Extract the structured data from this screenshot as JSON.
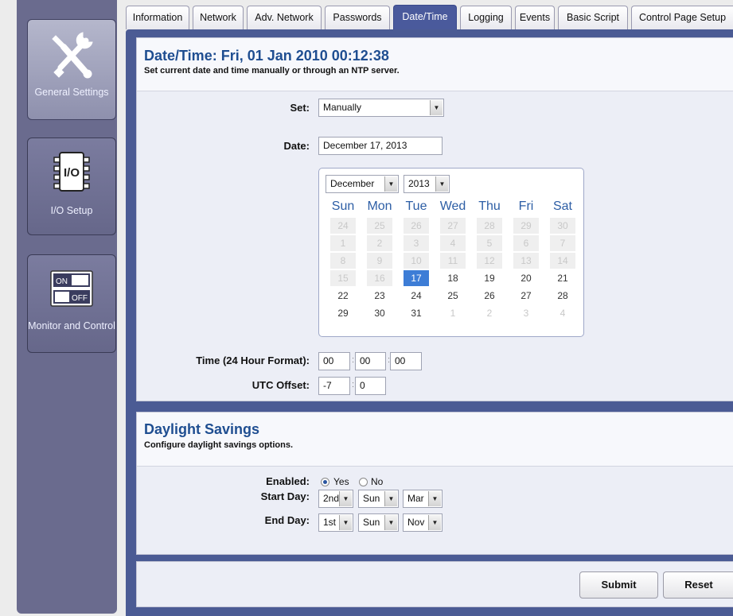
{
  "sidebar": {
    "general": "General Settings",
    "io": "I/O Setup",
    "monitor": "Monitor and Control",
    "io_icon_text": "I/O",
    "on_text": "ON",
    "off_text": "OFF"
  },
  "tabs": [
    "Information",
    "Network",
    "Adv. Network",
    "Passwords",
    "Date/Time",
    "Logging",
    "Events",
    "Basic Script",
    "Control Page Setup"
  ],
  "datetime": {
    "title": "Date/Time: Fri, 01 Jan 2010 00:12:38",
    "subtitle": "Set current date and time manually or through an NTP server.",
    "set_label": "Set:",
    "set_value": "Manually",
    "date_label": "Date:",
    "date_value": "December 17, 2013",
    "time_label": "Time (24 Hour Format):",
    "time_h": "00",
    "time_m": "00",
    "time_s": "00",
    "utc_label": "UTC Offset:",
    "utc_h": "-7",
    "utc_m": "0"
  },
  "calendar": {
    "month": "December",
    "year": "2013",
    "weekdays": [
      "Sun",
      "Mon",
      "Tue",
      "Wed",
      "Thu",
      "Fri",
      "Sat"
    ],
    "selected_day": "17",
    "weeks": [
      [
        "24",
        "25",
        "26",
        "27",
        "28",
        "29",
        "30"
      ],
      [
        "1",
        "2",
        "3",
        "4",
        "5",
        "6",
        "7"
      ],
      [
        "8",
        "9",
        "10",
        "11",
        "12",
        "13",
        "14"
      ],
      [
        "15",
        "16",
        "17",
        "18",
        "19",
        "20",
        "21"
      ],
      [
        "22",
        "23",
        "24",
        "25",
        "26",
        "27",
        "28"
      ],
      [
        "29",
        "30",
        "31",
        "1",
        "2",
        "3",
        "4"
      ]
    ]
  },
  "daylight": {
    "title": "Daylight Savings",
    "subtitle": "Configure daylight savings options.",
    "enabled_label": "Enabled:",
    "yes": "Yes",
    "no": "No",
    "start_label": "Start Day:",
    "start_week": "2nd",
    "start_dow": "Sun",
    "start_month": "Mar",
    "end_label": "End Day:",
    "end_week": "1st",
    "end_dow": "Sun",
    "end_month": "Nov"
  },
  "actions": {
    "submit": "Submit",
    "reset": "Reset"
  },
  "colors": {
    "sidebar": "#6a6b8e",
    "tab_active": "#4a5a9c",
    "frame": "#4b5b94",
    "title": "#1f4e91",
    "selected_day": "#3d7dd6"
  }
}
